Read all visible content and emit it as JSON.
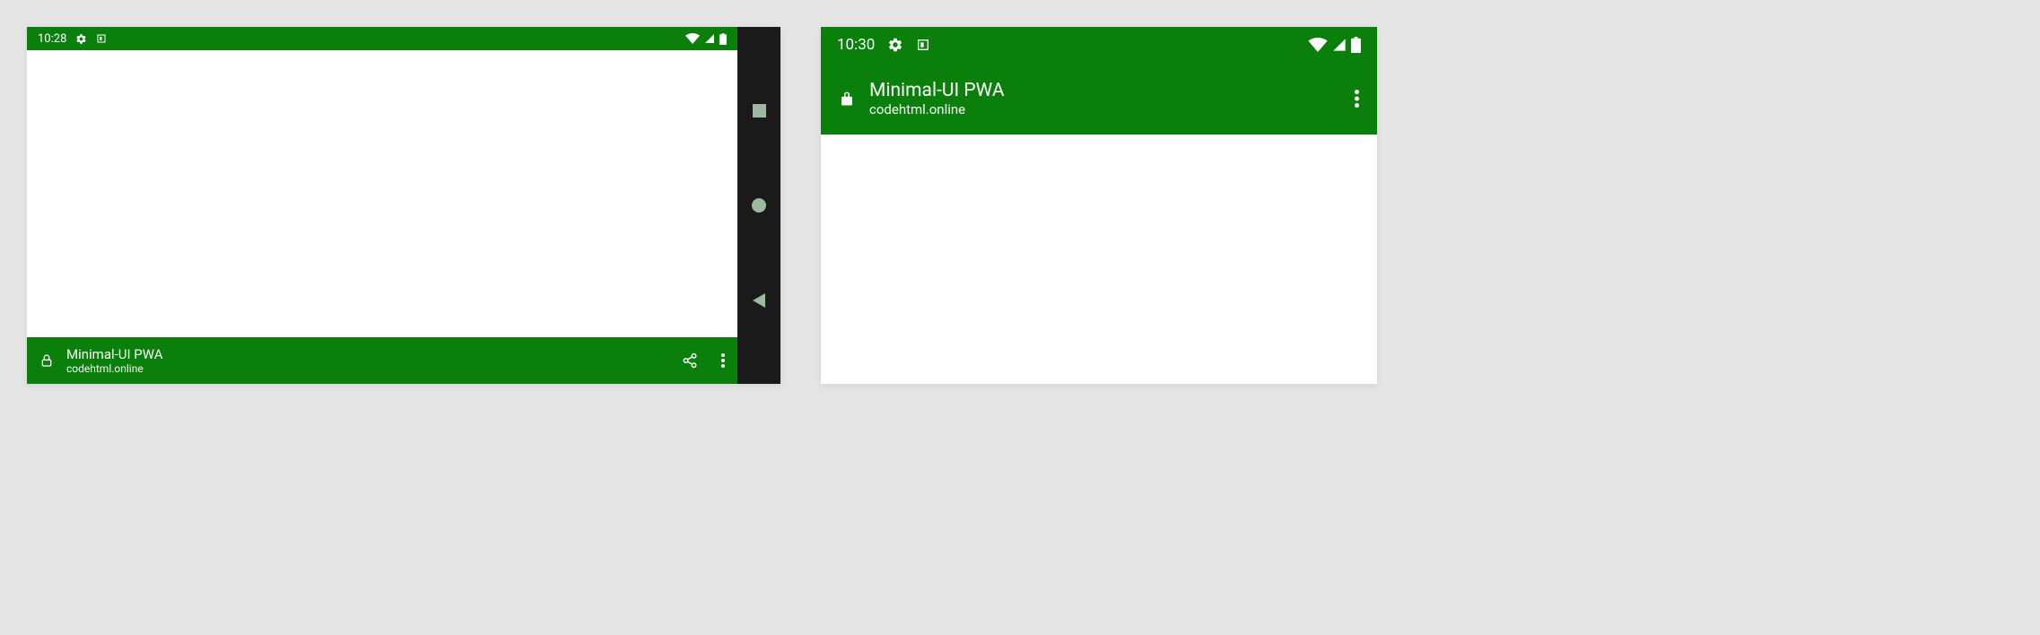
{
  "devices": {
    "landscape": {
      "status_time": "10:28",
      "app_title": "Minimal-UI PWA",
      "app_subtitle": "codehtml.online"
    },
    "portrait": {
      "status_time": "10:30",
      "app_title": "Minimal-UI PWA",
      "app_subtitle": "codehtml.online"
    }
  },
  "colors": {
    "theme": "#0b7f0b",
    "nav_bg": "#1a1a1a",
    "nav_icon": "#9db89d"
  }
}
